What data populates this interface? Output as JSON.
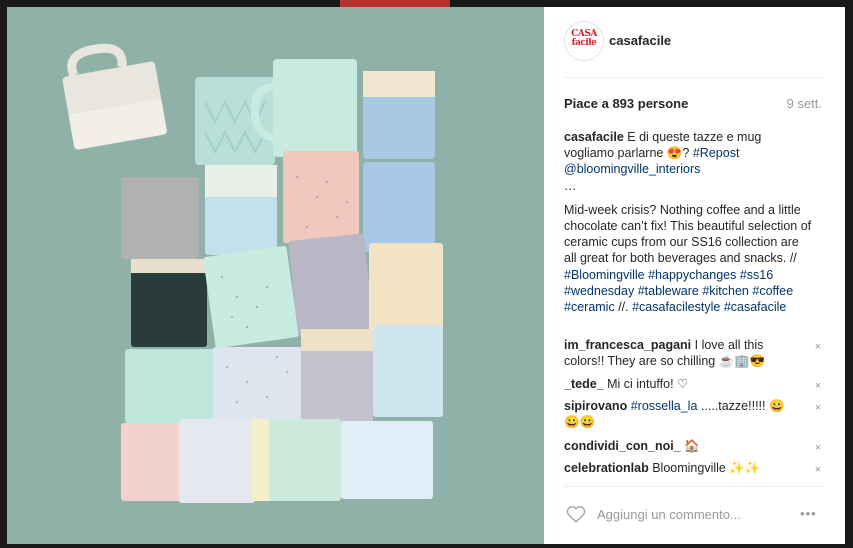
{
  "post": {
    "username": "casafacile",
    "avatar_logo": "CASA facile",
    "likes_prefix": "Piace a ",
    "likes_count": "893",
    "likes_suffix": " persone",
    "time_ago": "9 sett.",
    "caption": {
      "username": "casafacile",
      "line1": " E di queste tazze e mug vogliamo parlarne ",
      "emoji1": "😍",
      "after_emoji": "? ",
      "tag_repost": "#Repost",
      "mention": "@bloomingville_interiors",
      "ellipsis": "…",
      "body": "Mid-week crisis? Nothing coffee and a little chocolate can’t fix! This beautiful selection of ceramic cups from our SS16 collection are all great for both beverages and snacks. // ",
      "tags": [
        "#Bloomingville",
        "#happychanges",
        "#ss16",
        "#wednesday",
        "#tableware",
        "#kitchen",
        "#coffee",
        "#ceramic"
      ],
      "sep": " //. ",
      "tags2": [
        "#casafacilestyle",
        "#casafacile"
      ]
    },
    "comments": [
      {
        "user": "im_francesca_pagani",
        "text": " I love all this colors!! They are so chilling ☕🏢😎"
      },
      {
        "user": "_tede_",
        "text": " Mi ci intuffo! ♡"
      },
      {
        "user": "sipirovano",
        "tag": "#rossella_la",
        "text": " .....tazze!!!!! 😀😀😀"
      },
      {
        "user": "condividi_con_noi_",
        "text": " 🏠"
      },
      {
        "user": "celebrationlab",
        "text": " Bloomingville ✨✨"
      }
    ],
    "add_comment_placeholder": "Aggiungi un commento...",
    "more_label": "•••",
    "delete_label": "×"
  },
  "colors": {
    "photo_bg": "#8fb1a7",
    "link": "#003569",
    "text": "#262626",
    "muted": "#999999"
  }
}
